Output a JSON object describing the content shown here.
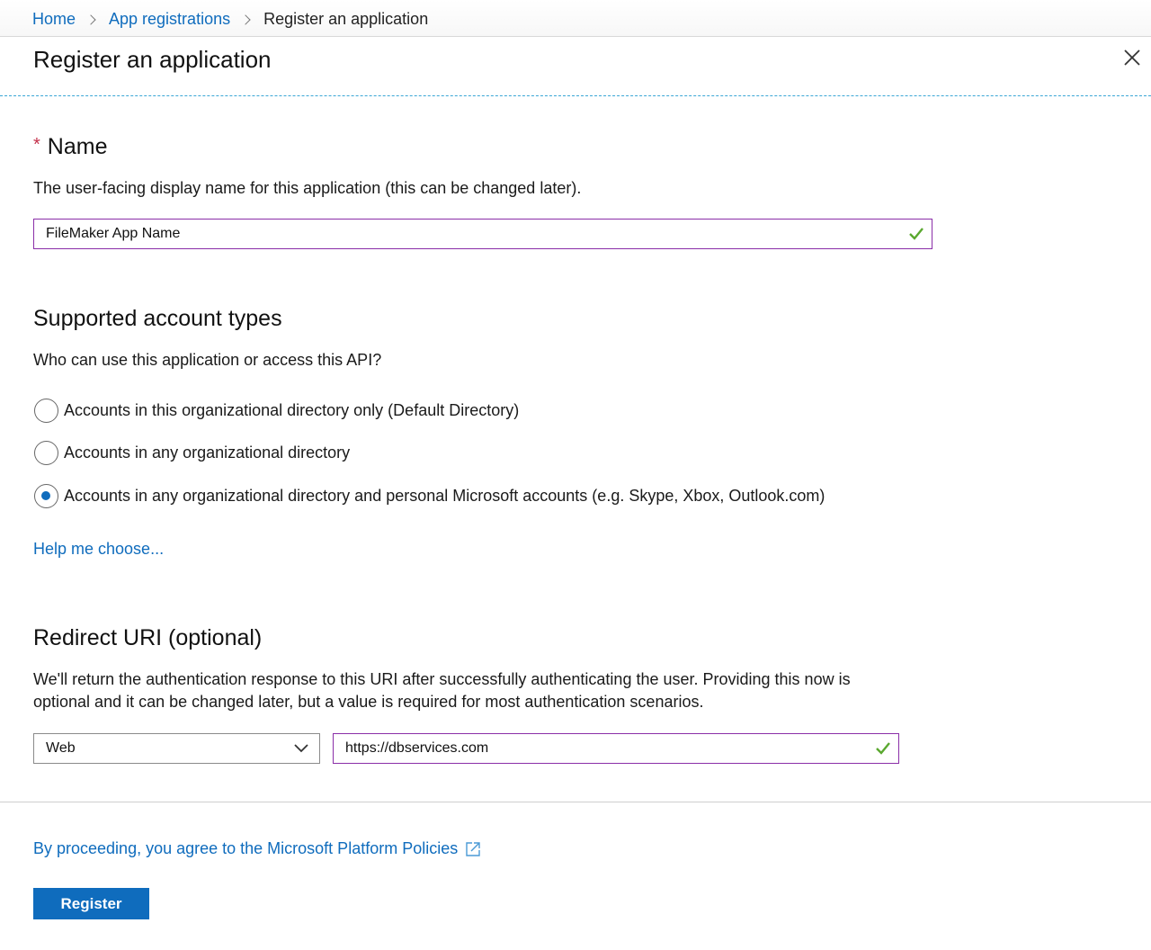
{
  "breadcrumb": {
    "items": [
      "Home",
      "App registrations"
    ],
    "current": "Register an application"
  },
  "page": {
    "title": "Register an application"
  },
  "icons": {
    "close": "close-icon",
    "check": "check-icon",
    "chevron": "chevron-down-icon",
    "external": "external-link-icon"
  },
  "colors": {
    "accent": "#0f6cbd",
    "focus_border": "#8a2ea8",
    "valid": "#5aa82f",
    "required": "#c4314b"
  },
  "name_section": {
    "heading": "Name",
    "required_marker": "*",
    "description": "The user-facing display name for this application (this can be changed later).",
    "value": "FileMaker App Name"
  },
  "account_types": {
    "heading": "Supported account types",
    "description": "Who can use this application or access this API?",
    "options": [
      {
        "label": "Accounts in this organizational directory only (Default Directory)",
        "selected": false
      },
      {
        "label": "Accounts in any organizational directory",
        "selected": false
      },
      {
        "label": "Accounts in any organizational directory and personal Microsoft accounts (e.g. Skype, Xbox, Outlook.com)",
        "selected": true
      }
    ],
    "help_link": "Help me choose..."
  },
  "redirect": {
    "heading": "Redirect URI (optional)",
    "description_line1": "We'll return the authentication response to this URI after successfully authenticating the user. Providing this now is",
    "description_line2": "optional and it can be changed later, but a value is required for most authentication scenarios.",
    "platform": "Web",
    "uri": "https://dbservices.com"
  },
  "footer": {
    "policy_text": "By proceeding, you agree to the Microsoft Platform Policies",
    "register_label": "Register"
  }
}
